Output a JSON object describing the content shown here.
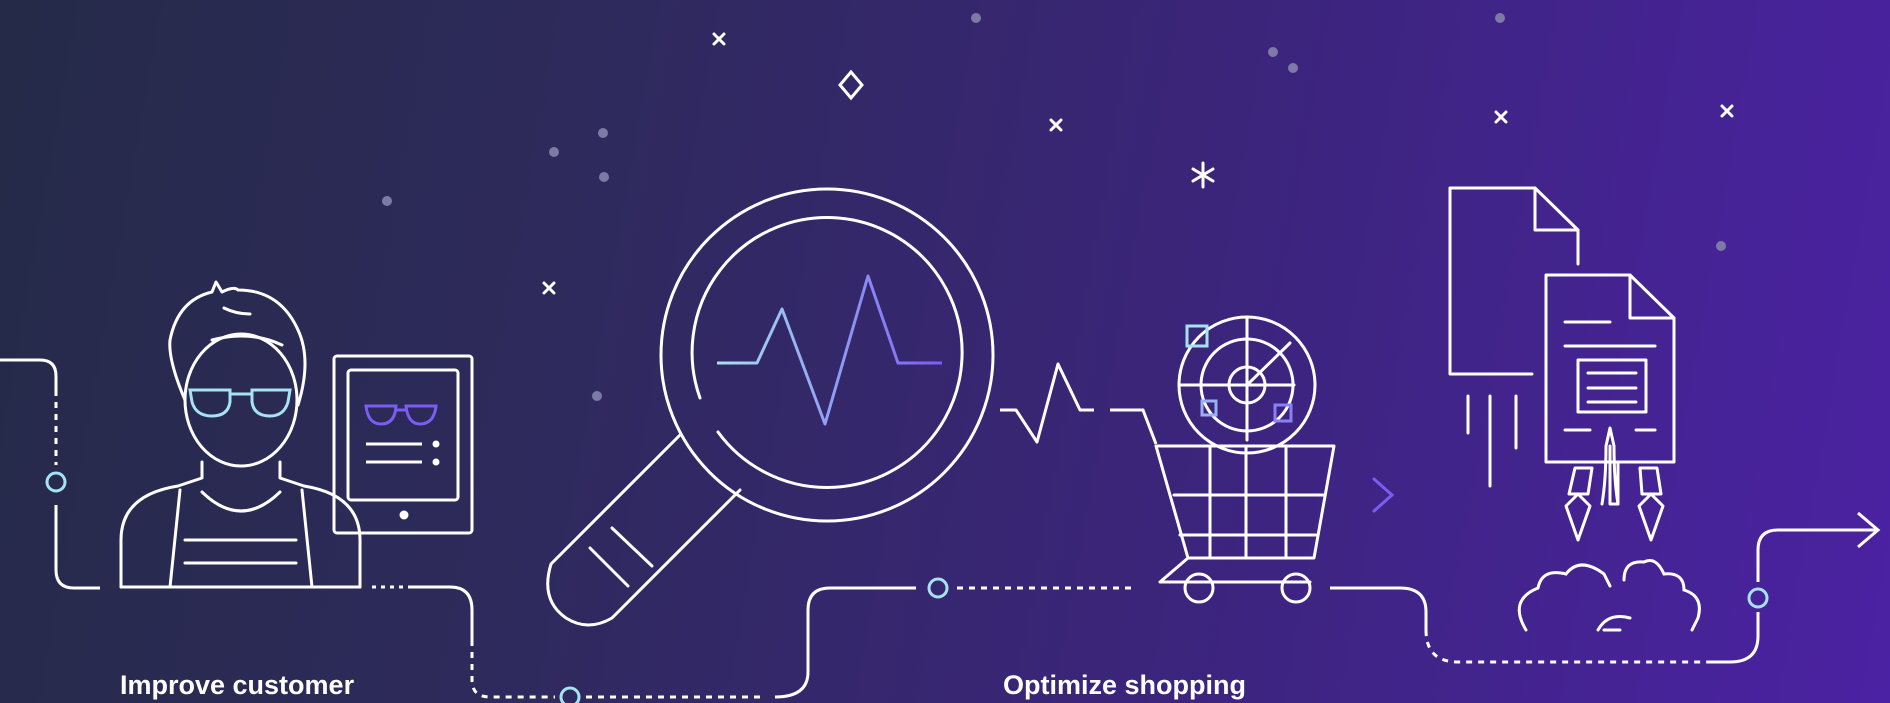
{
  "captions": {
    "left": "Improve customer",
    "middle": "Optimize shopping"
  },
  "colors": {
    "background_start": "#252a48",
    "background_end": "#4b22a3",
    "line": "#ffffff",
    "accent_light": "#a6e3f0",
    "accent_purple": "#7b5cf5"
  },
  "icons": [
    "customer-person-icon",
    "tablet-icon",
    "magnifying-glass-icon",
    "shopping-cart-icon",
    "radar-icon",
    "document-icon",
    "rocket-icon",
    "cloud-icon",
    "arrow-right-icon"
  ]
}
